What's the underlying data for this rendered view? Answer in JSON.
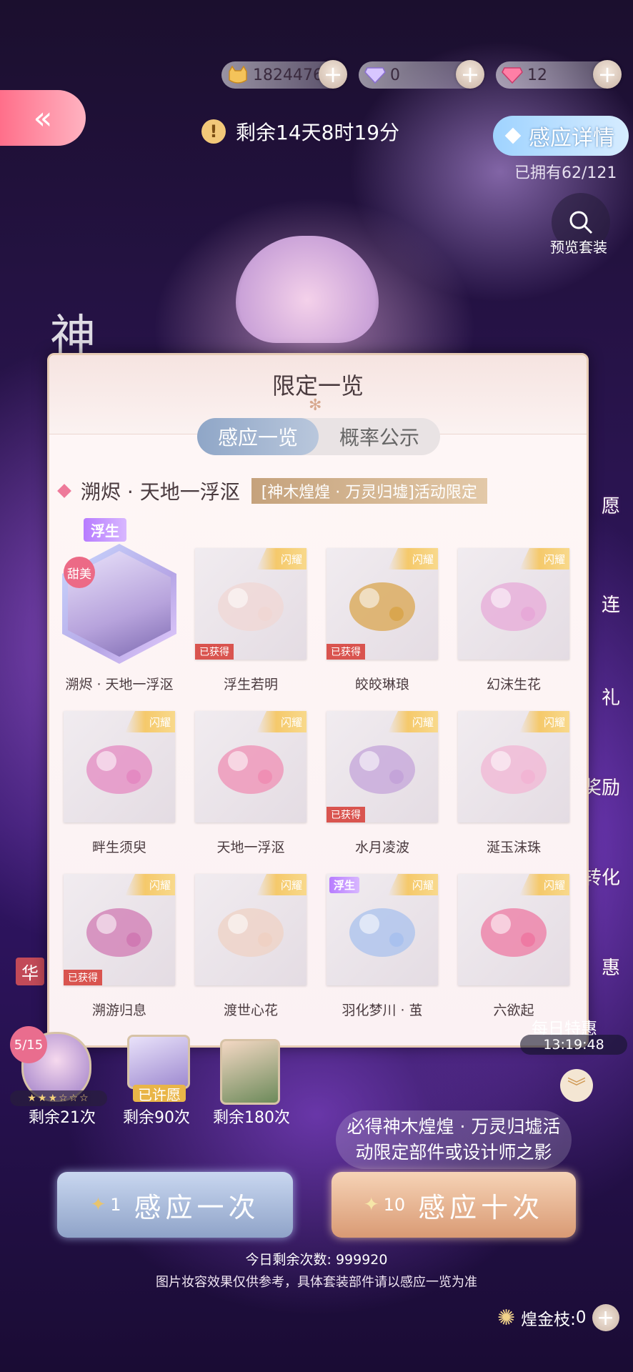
{
  "currency": {
    "gold": "1824476",
    "diamond": "0",
    "crystal": "12",
    "plus": "+"
  },
  "header": {
    "back": "«",
    "timer_icon": "!",
    "timer": "剩余14天8时19分",
    "detail_button": "感应详情",
    "owned": "已拥有62/121",
    "preview_label": "预览套装"
  },
  "modal": {
    "title": "限定一览",
    "tabs": [
      "感应一览",
      "概率公示"
    ],
    "active_tab": 0,
    "suit_name": "溯烬 · 天地一浮沤",
    "limit_tag": "[神木煌煌 · 万灵归墟]活动限定",
    "fusheng_label": "浮生",
    "items": [
      {
        "name": "溯烬 · 天地一浮沤",
        "featured": true,
        "badge": "甜美",
        "shine": "",
        "obtained": false,
        "fusheng": false,
        "hue": "#b6a6e6"
      },
      {
        "name": "浮生若明",
        "featured": false,
        "badge": "",
        "shine": "闪耀",
        "obtained": true,
        "obtained_label": "已获得",
        "fusheng": false,
        "hue": "#f0d7d4"
      },
      {
        "name": "皎皎琳琅",
        "featured": false,
        "badge": "",
        "shine": "闪耀",
        "obtained": true,
        "obtained_label": "已获得",
        "fusheng": false,
        "hue": "#d9a64f"
      },
      {
        "name": "幻沫生花",
        "featured": false,
        "badge": "",
        "shine": "闪耀",
        "obtained": false,
        "fusheng": false,
        "hue": "#e7a9d8"
      },
      {
        "name": "畔生须臾",
        "featured": false,
        "badge": "",
        "shine": "闪耀",
        "obtained": false,
        "fusheng": false,
        "hue": "#e48ac2"
      },
      {
        "name": "天地一浮沤",
        "featured": false,
        "badge": "",
        "shine": "闪耀",
        "obtained": false,
        "fusheng": false,
        "hue": "#ef8fb4"
      },
      {
        "name": "水月凌波",
        "featured": false,
        "badge": "",
        "shine": "闪耀",
        "obtained": true,
        "obtained_label": "已获得",
        "fusheng": false,
        "hue": "#c4a4d9"
      },
      {
        "name": "涎玉沫珠",
        "featured": false,
        "badge": "",
        "shine": "闪耀",
        "obtained": false,
        "fusheng": false,
        "hue": "#f2b5d4"
      },
      {
        "name": "溯游归息",
        "featured": false,
        "badge": "",
        "shine": "闪耀",
        "obtained": true,
        "obtained_label": "已获得",
        "fusheng": false,
        "hue": "#d07ab3"
      },
      {
        "name": "渡世心花",
        "featured": false,
        "badge": "",
        "shine": "闪耀",
        "obtained": false,
        "fusheng": false,
        "hue": "#efd1c4"
      },
      {
        "name": "羽化梦川 · 茧",
        "featured": false,
        "badge": "",
        "shine": "闪耀",
        "obtained": false,
        "fusheng": true,
        "fusheng_label": "浮生",
        "hue": "#a9c1ee"
      },
      {
        "name": "六欲起",
        "featured": false,
        "badge": "",
        "shine": "闪耀",
        "obtained": false,
        "fusheng": false,
        "hue": "#ee7aa3"
      }
    ]
  },
  "side": {
    "items": [
      "愿",
      "连",
      "礼",
      "奖励",
      "转化",
      "惠"
    ],
    "left_tag": "华",
    "left_char": "神"
  },
  "pools": {
    "badge": "5/15",
    "stars": "★★★☆☆☆",
    "wished": "已许愿",
    "labels": [
      "剩余21次",
      "剩余90次",
      "剩余180次"
    ]
  },
  "daily_deal": {
    "label": "每日特惠",
    "countdown": "13:19:48",
    "chevron": "︾"
  },
  "draw": {
    "subtitle_line1": "必得神木煌煌 · 万灵归墟活",
    "subtitle_line2": "动限定部件或设计师之影",
    "one_cost": "1",
    "one_label": "感应一次",
    "ten_cost": "10",
    "ten_label": "感应十次"
  },
  "footer": {
    "daily_remaining": "今日剩余次数:  999920",
    "disclaimer": "图片妆容效果仅供参考，具体套装部件请以感应一览为准",
    "currency_label": "煌金枝:",
    "currency_value": "0"
  },
  "colors": {
    "accent_pink": "#ec6a86",
    "detail_blue": "#9fd3ff",
    "obtained_red": "#d9544f",
    "shine_gold": "#f5c96b"
  }
}
